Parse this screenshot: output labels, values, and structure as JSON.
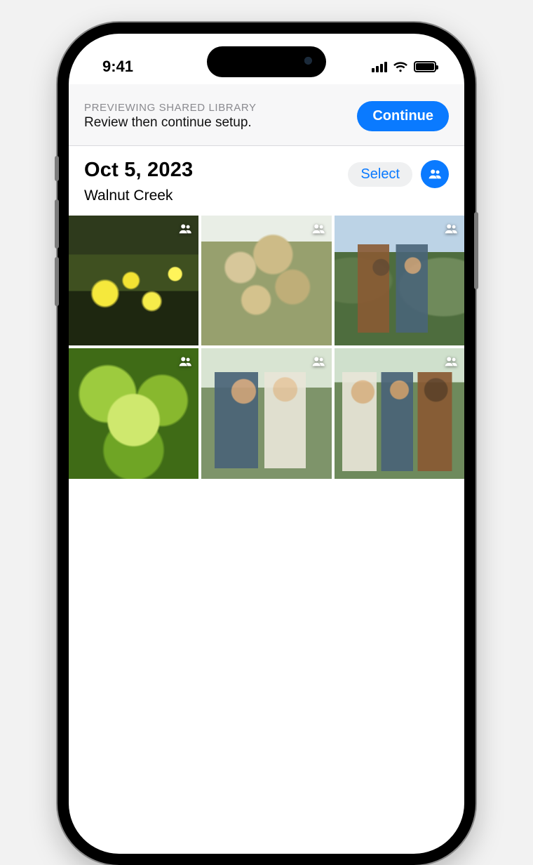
{
  "status": {
    "time": "9:41"
  },
  "banner": {
    "eyebrow": "PREVIEWING SHARED LIBRARY",
    "subtitle": "Review then continue setup.",
    "continue_label": "Continue"
  },
  "section": {
    "date": "Oct 5, 2023",
    "location": "Walnut Creek",
    "select_label": "Select"
  },
  "photos": [
    {
      "shared": true
    },
    {
      "shared": true
    },
    {
      "shared": true
    },
    {
      "shared": true
    },
    {
      "shared": true
    },
    {
      "shared": true
    }
  ],
  "colors": {
    "accent": "#0a7aff"
  }
}
